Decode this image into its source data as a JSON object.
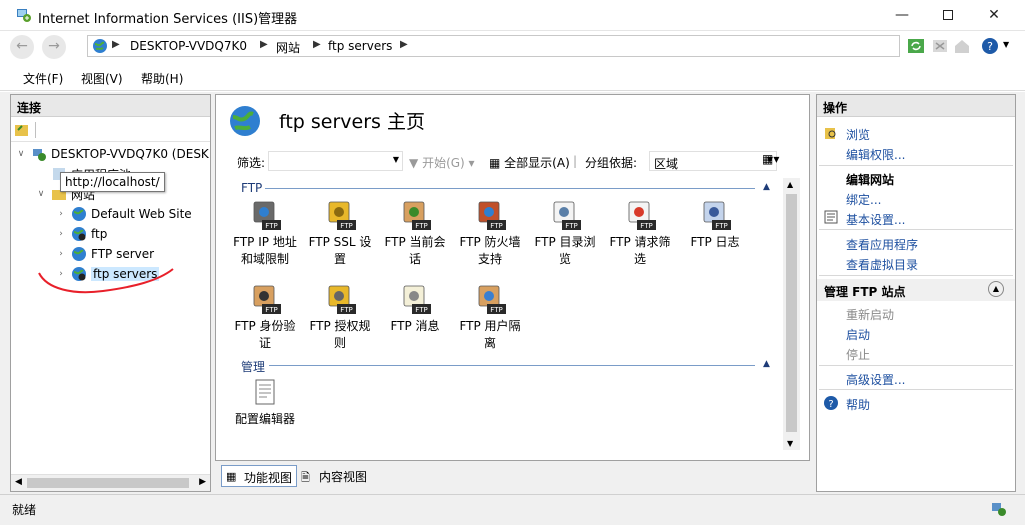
{
  "window": {
    "title": "Internet Information Services (IIS)管理器"
  },
  "address": {
    "crumbs": [
      "DESKTOP-VVDQ7K0",
      "网站",
      "ftp servers"
    ]
  },
  "menu": {
    "file": "文件(F)",
    "view": "视图(V)",
    "help": "帮助(H)"
  },
  "connections": {
    "header": "连接",
    "tree": {
      "root": "DESKTOP-VVDQ7K0 (DESK",
      "app_pools": "应用程序池",
      "sites": "网站",
      "site_items": [
        "Default Web Site",
        "ftp",
        "FTP server",
        "ftp servers"
      ]
    },
    "tooltip": "http://localhost/"
  },
  "center": {
    "title": "ftp servers 主页",
    "filter": {
      "label": "筛选:",
      "start": "开始(G)",
      "show_all": "全部显示(A)",
      "group_label": "分组依据:",
      "group_value": "区域"
    },
    "sections": {
      "ftp": "FTP",
      "manage": "管理"
    },
    "ftp_features": [
      [
        "FTP IP 地址",
        "和域限制"
      ],
      [
        "FTP SSL 设",
        "置"
      ],
      [
        "FTP 当前会",
        "话"
      ],
      [
        "FTP 防火墙",
        "支持"
      ],
      [
        "FTP 目录浏",
        "览"
      ],
      [
        "FTP 请求筛",
        "选"
      ],
      [
        "FTP 日志",
        ""
      ],
      [
        "FTP 身份验",
        "证"
      ],
      [
        "FTP 授权规",
        "则"
      ],
      [
        "FTP 消息",
        ""
      ],
      [
        "FTP 用户隔",
        "离"
      ]
    ],
    "manage_features": [
      [
        "配置编辑器",
        ""
      ]
    ],
    "icon_badge": "FTP",
    "view_tabs": {
      "features": "功能视图",
      "content": "内容视图"
    }
  },
  "actions": {
    "header": "操作",
    "explore": "浏览",
    "edit_permissions": "编辑权限...",
    "edit_site": "编辑网站",
    "bindings": "绑定...",
    "basic_settings": "基本设置...",
    "view_apps": "查看应用程序",
    "view_vdirs": "查看虚拟目录",
    "manage_ftp": "管理 FTP 站点",
    "restart": "重新启动",
    "start": "启动",
    "stop": "停止",
    "advanced": "高级设置...",
    "help": "帮助"
  },
  "status": {
    "text": "就绪"
  },
  "colors": {
    "link": "#1e50a0",
    "selection": "#cce8ff",
    "section": "#1e3c78",
    "annotation": "#e8202a"
  }
}
